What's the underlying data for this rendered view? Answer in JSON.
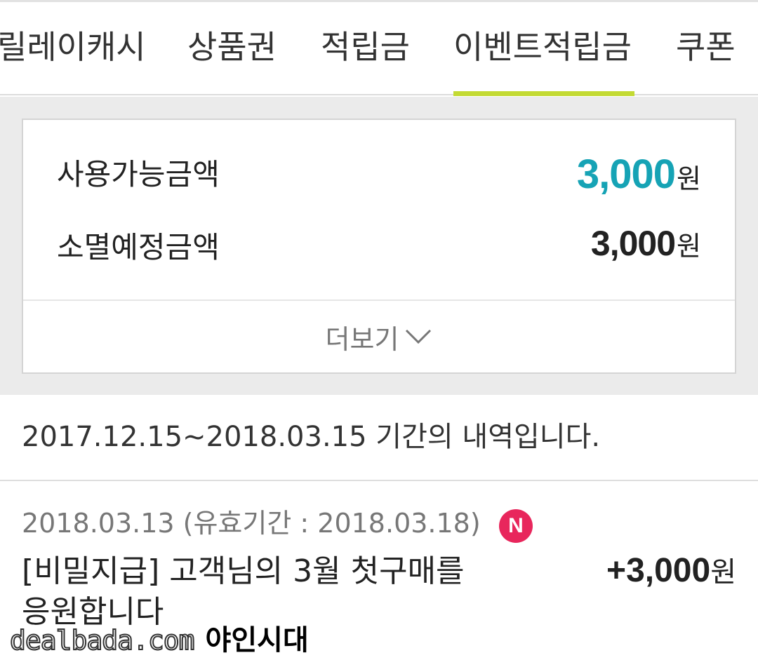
{
  "tabs": [
    {
      "label": "릴레이캐시"
    },
    {
      "label": "상품권"
    },
    {
      "label": "적립금"
    },
    {
      "label": "이벤트적립금",
      "active": true
    },
    {
      "label": "쿠폰"
    }
  ],
  "colors": {
    "accent_underline": "#c3da33",
    "amount_teal": "#16a3b5",
    "badge": "#e8265c"
  },
  "summary": {
    "available_label": "사용가능금액",
    "available_value": "3,000",
    "expiring_label": "소멸예정금액",
    "expiring_value": "3,000",
    "unit": "원",
    "more_label": "더보기",
    "more_icon": "chevron-down-icon"
  },
  "period_text": "2017.12.15~2018.03.15 기간의 내역입니다.",
  "entries": [
    {
      "date": "2018.03.13 (유효기간 : 2018.03.18)",
      "badge": "N",
      "title": "[비밀지급] 고객님의 3월 첫구매를 응원합니다",
      "amount": "+3,000",
      "unit": "원"
    }
  ],
  "watermark": {
    "site": "dealbada.com",
    "brand": "야인시대"
  }
}
